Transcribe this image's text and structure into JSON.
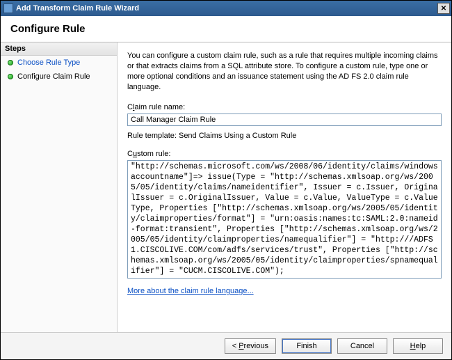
{
  "window": {
    "title": "Add Transform Claim Rule Wizard"
  },
  "header": {
    "title": "Configure Rule"
  },
  "steps": {
    "header": "Steps",
    "items": [
      {
        "label": "Choose Rule Type",
        "current": false
      },
      {
        "label": "Configure Claim Rule",
        "current": true
      }
    ]
  },
  "content": {
    "description": "You can configure a custom claim rule, such as a rule that requires multiple incoming claims or that extracts claims from a SQL attribute store. To configure a custom rule, type one or more optional conditions and an issuance statement using the AD FS 2.0 claim rule language.",
    "claim_rule_name_label_pre": "C",
    "claim_rule_name_label_u": "l",
    "claim_rule_name_label_post": "aim rule name:",
    "claim_rule_name_value": "Call Manager Claim Rule",
    "rule_template_label": "Rule template: Send Claims Using a Custom Rule",
    "custom_rule_label_pre": "C",
    "custom_rule_label_u": "u",
    "custom_rule_label_post": "stom rule:",
    "custom_rule_value": "\"http://schemas.microsoft.com/ws/2008/06/identity/claims/windowsaccountname\"]=> issue(Type = \"http://schemas.xmlsoap.org/ws/2005/05/identity/claims/nameidentifier\", Issuer = c.Issuer, OriginalIssuer = c.OriginalIssuer, Value = c.Value, ValueType = c.ValueType, Properties [\"http://schemas.xmlsoap.org/ws/2005/05/identity/claimproperties/format\"] = \"urn:oasis:names:tc:SAML:2.0:nameid-format:transient\", Properties [\"http://schemas.xmlsoap.org/ws/2005/05/identity/claimproperties/namequalifier\"] = \"http:///ADFS1.CISCOLIVE.COM/com/adfs/services/trust\", Properties [\"http://schemas.xmlsoap.org/ws/2005/05/identity/claimproperties/spnamequalifier\"] = \"CUCM.CISCOLIVE.COM\");",
    "more_link": "More about the claim rule language..."
  },
  "buttons": {
    "previous_pre": "< ",
    "previous_u": "P",
    "previous_post": "revious",
    "finish": "Finish",
    "cancel": "Cancel",
    "help_u": "H",
    "help_post": "elp"
  }
}
